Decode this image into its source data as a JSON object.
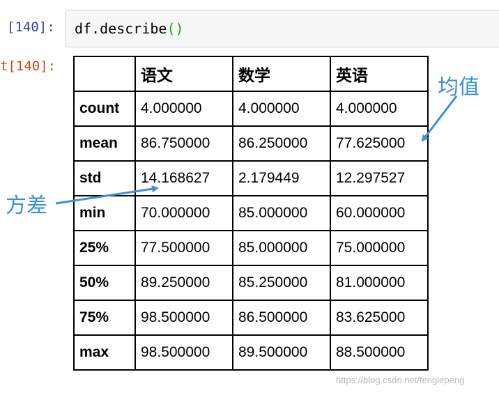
{
  "input_prompt": "[140]:",
  "output_prompt": "t[140]:",
  "code": {
    "text": "df.describe",
    "parens": "()"
  },
  "table": {
    "corner": "",
    "columns": [
      "语文",
      "数学",
      "英语"
    ],
    "rows": [
      {
        "label": "count",
        "values": [
          "4.000000",
          "4.000000",
          "4.000000"
        ]
      },
      {
        "label": "mean",
        "values": [
          "86.750000",
          "86.250000",
          "77.625000"
        ]
      },
      {
        "label": "std",
        "values": [
          "14.168627",
          "2.179449",
          "12.297527"
        ]
      },
      {
        "label": "min",
        "values": [
          "70.000000",
          "85.000000",
          "60.000000"
        ]
      },
      {
        "label": "25%",
        "values": [
          "77.500000",
          "85.000000",
          "75.000000"
        ]
      },
      {
        "label": "50%",
        "values": [
          "89.250000",
          "85.250000",
          "81.000000"
        ]
      },
      {
        "label": "75%",
        "values": [
          "98.500000",
          "86.500000",
          "83.625000"
        ]
      },
      {
        "label": "max",
        "values": [
          "98.500000",
          "89.500000",
          "88.500000"
        ]
      }
    ]
  },
  "annotations": {
    "mean": "均值",
    "std": "方差"
  },
  "watermark": "https://blog.csdn.net/fenglepeng",
  "colors": {
    "annotation": "#3d8fd8",
    "input_prompt": "#303f9f",
    "output_prompt": "#d84315",
    "paren": "#22a022"
  }
}
